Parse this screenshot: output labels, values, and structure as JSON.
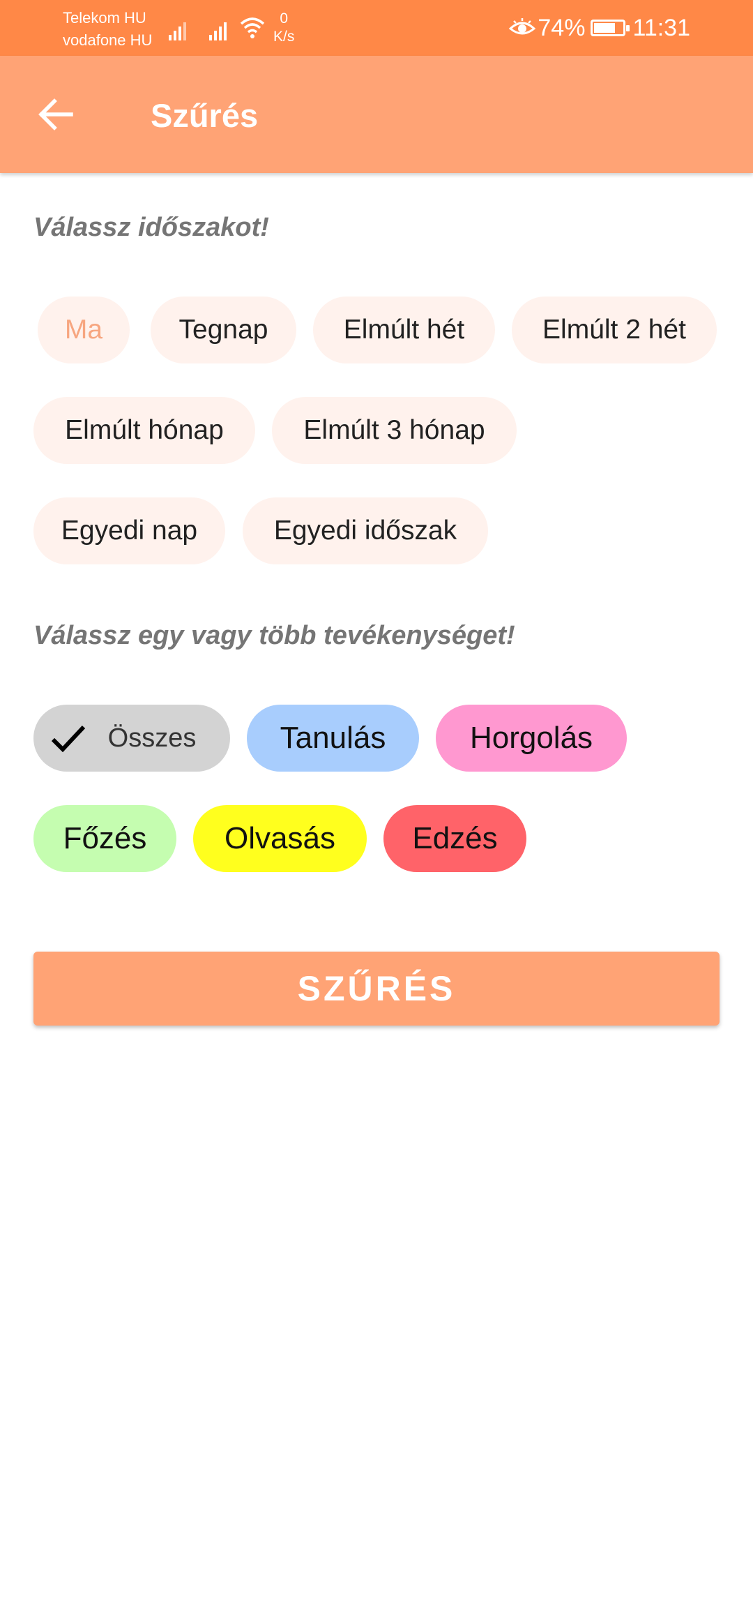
{
  "status_bar": {
    "carrier1": "Telekom HU",
    "carrier2": "vodafone HU",
    "speed_value": "0",
    "speed_unit": "K/s",
    "battery_percent": "74%",
    "battery_level": 0.74,
    "time": "11:31"
  },
  "app_bar": {
    "back_icon": "arrow-left-icon",
    "title": "Szűrés"
  },
  "period_section": {
    "label": "Válassz időszakot!",
    "selected": "Ma",
    "chips": [
      "Ma",
      "Tegnap",
      "Elmúlt hét",
      "Elmúlt 2 hét",
      "Elmúlt hónap",
      "Elmúlt 3 hónap",
      "Egyedi nap",
      "Egyedi időszak"
    ]
  },
  "activity_section": {
    "label": "Válassz egy vagy több tevékenységet!",
    "chips": [
      {
        "label": "Összes",
        "color": "#d3d3d3",
        "checked": true
      },
      {
        "label": "Tanulás",
        "color": "#a8cdfd",
        "checked": false
      },
      {
        "label": "Horgolás",
        "color": "#ff98d0",
        "checked": false
      },
      {
        "label": "Főzés",
        "color": "#c5fdb0",
        "checked": false
      },
      {
        "label": "Olvasás",
        "color": "#ffff1e",
        "checked": false
      },
      {
        "label": "Edzés",
        "color": "#ff6369",
        "checked": false
      }
    ]
  },
  "filter_button": {
    "label": "SZŰRÉS",
    "color": "#ffa375"
  },
  "colors": {
    "status_bar": "#ff8847",
    "app_bar": "#ffa375",
    "period_chip_bg": "#fff2ed",
    "period_selected_text": "#f7a680"
  }
}
